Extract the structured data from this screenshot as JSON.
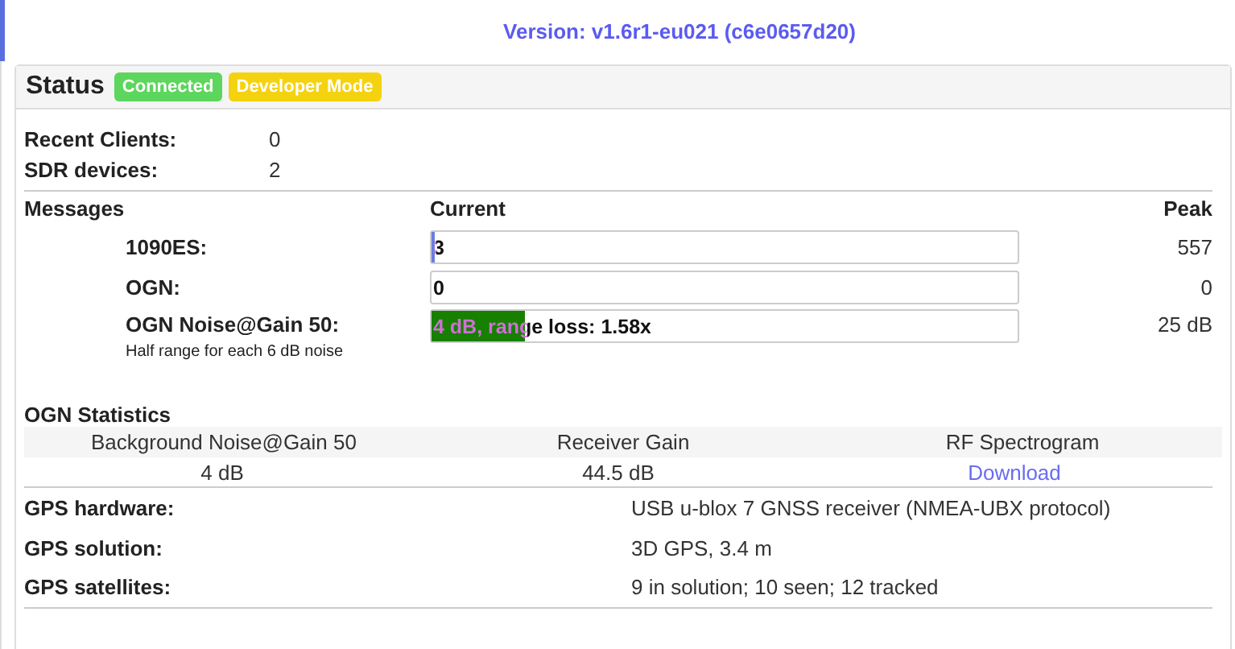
{
  "version": "Version: v1.6r1-eu021 (c6e0657d20)",
  "status": {
    "title": "Status",
    "badges": [
      {
        "label": "Connected",
        "color": "#5cd65c"
      },
      {
        "label": "Developer Mode",
        "color": "#f5d20f"
      }
    ]
  },
  "summary": [
    {
      "label": "Recent Clients:",
      "value": "0"
    },
    {
      "label": "SDR devices:",
      "value": "2"
    }
  ],
  "messages": {
    "headers": [
      "Messages",
      "Current",
      "Peak"
    ],
    "rows": [
      {
        "label": "1090ES:",
        "value": "3",
        "level": 0.006,
        "color": "#6b7fe0",
        "peak": "557"
      },
      {
        "label": "OGN:",
        "value": "0",
        "level": 0,
        "peak": "0"
      },
      {
        "label": "OGN Noise@Gain 50:",
        "note": "Half range for each 6 dB noise",
        "value": "4 dB, range loss: 1.58x",
        "level": 0.16,
        "color": "#178000",
        "peak": "25 dB"
      }
    ]
  },
  "ogn_statistics": {
    "title": "OGN Statistics",
    "columns": [
      "Background Noise@Gain 50",
      "Receiver Gain",
      "RF Spectrogram"
    ],
    "cells": [
      {
        "text": "4 dB",
        "kind": "text"
      },
      {
        "text": "44.5 dB",
        "kind": "text"
      },
      {
        "text": "Download",
        "kind": "link"
      }
    ]
  },
  "gps": [
    {
      "label": "GPS hardware:",
      "value": "USB u-blox 7 GNSS receiver (NMEA-UBX protocol)"
    },
    {
      "label": "GPS solution:",
      "value": "3D GPS, 3.4 m"
    },
    {
      "label": "GPS satellites:",
      "value": "9 in solution; 10 seen; 12 tracked"
    }
  ]
}
